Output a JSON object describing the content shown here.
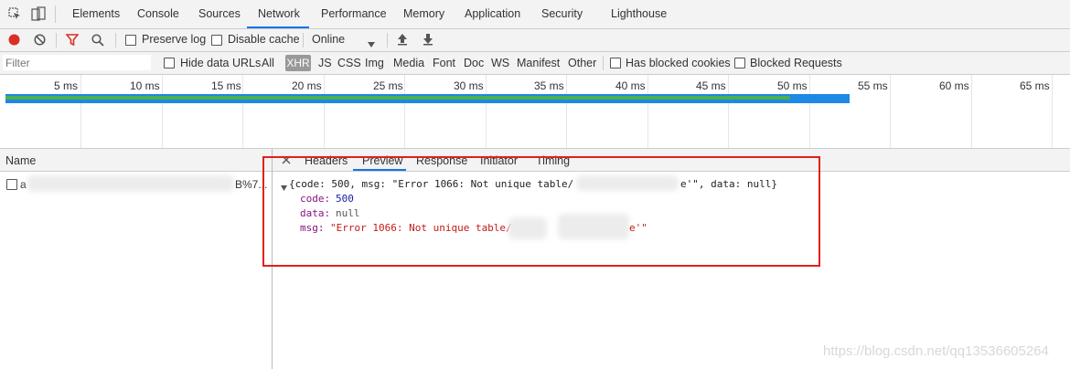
{
  "devtools_tabs": [
    {
      "label": "Elements"
    },
    {
      "label": "Console"
    },
    {
      "label": "Sources"
    },
    {
      "label": "Network"
    },
    {
      "label": "Performance"
    },
    {
      "label": "Memory"
    },
    {
      "label": "Application"
    },
    {
      "label": "Security"
    },
    {
      "label": "Lighthouse"
    }
  ],
  "toolbar": {
    "preserve_log": "Preserve log",
    "disable_cache": "Disable cache",
    "throttle_value": "Online"
  },
  "filterbar": {
    "filter_placeholder": "Filter",
    "hide_data_urls": "Hide data URLs",
    "types": [
      "All",
      "XHR",
      "JS",
      "CSS",
      "Img",
      "Media",
      "Font",
      "Doc",
      "WS",
      "Manifest",
      "Other"
    ],
    "has_blocked_cookies": "Has blocked cookies",
    "blocked_requests": "Blocked Requests"
  },
  "timeline": {
    "ticks": [
      "5 ms",
      "10 ms",
      "15 ms",
      "20 ms",
      "25 ms",
      "30 ms",
      "35 ms",
      "40 ms",
      "45 ms",
      "50 ms",
      "55 ms",
      "60 ms",
      "65 ms"
    ]
  },
  "request_list": {
    "header": "Name",
    "row_prefix": "a",
    "row_suffix": "B%7..."
  },
  "detail_tabs": [
    {
      "label": "Headers"
    },
    {
      "label": "Preview"
    },
    {
      "label": "Response"
    },
    {
      "label": "Initiator"
    },
    {
      "label": "Timing"
    }
  ],
  "preview": {
    "summary_line": "{code: 500, msg: \"Error 1066: Not unique table/",
    "summary_tail": "e'\", data: null}",
    "code_key": "code:",
    "code_value": "500",
    "data_key": "data:",
    "data_value": "null",
    "msg_key": "msg:",
    "msg_value": "\"Error 1066: Not unique table/",
    "msg_tail": "e'\""
  },
  "watermark": "https://blog.csdn.net/qq13536605264",
  "colors": {
    "accent": "#1a73e8",
    "record_red": "#d93025",
    "highlight_box": "#e0201c",
    "string_red": "#c41a16",
    "number_blue": "#1a1aa6",
    "key_purple": "#881280"
  }
}
